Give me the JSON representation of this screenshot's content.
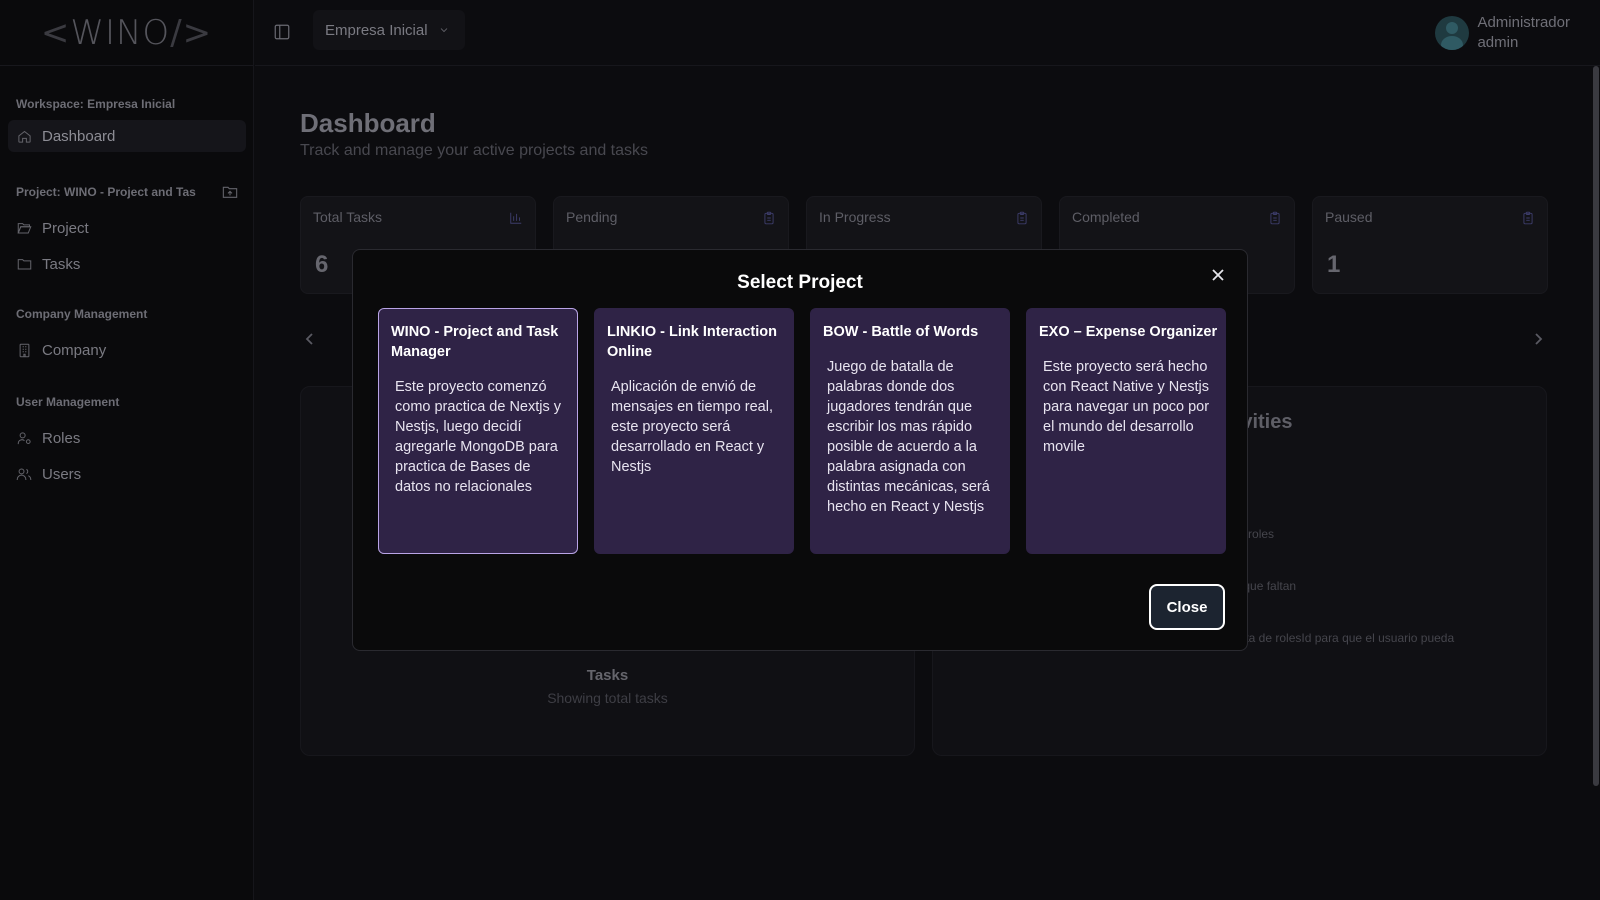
{
  "sidebar": {
    "logo": {
      "left": "<",
      "text": "WINO",
      "right": "/>"
    },
    "workspace_heading": "Workspace: Empresa Inicial",
    "dashboard_label": "Dashboard",
    "project_heading": "Project: WINO - Project and Tas",
    "project_items": [
      {
        "label": "Project",
        "icon": "folder-open-icon"
      },
      {
        "label": "Tasks",
        "icon": "folder-icon"
      }
    ],
    "company_heading": "Company Management",
    "company_items": [
      {
        "label": "Company",
        "icon": "building-icon"
      }
    ],
    "user_heading": "User Management",
    "user_items": [
      {
        "label": "Roles",
        "icon": "user-cog-icon"
      },
      {
        "label": "Users",
        "icon": "users-icon"
      }
    ]
  },
  "header": {
    "company_select": "Empresa Inicial",
    "user": {
      "name": "Administrador",
      "role": "admin"
    }
  },
  "main": {
    "title": "Dashboard",
    "subtitle": "Track and manage your active projects and tasks",
    "stats": [
      {
        "label": "Total Tasks",
        "value": "6",
        "icon": "bar-chart-icon"
      },
      {
        "label": "Pending",
        "value": "",
        "icon": "clipboard-icon"
      },
      {
        "label": "In Progress",
        "value": "",
        "icon": "clipboard-icon"
      },
      {
        "label": "Completed",
        "value": "",
        "icon": "clipboard-icon"
      },
      {
        "label": "Paused",
        "value": "1",
        "icon": "clipboard-icon"
      }
    ],
    "tasks_panel": {
      "caption": "Tasks",
      "sub": "Showing total tasks"
    },
    "activities_panel": {
      "title_visible": "ctivities",
      "items": [
        "ta de roles",
        "oles que faltan",
        "la vista de rolesId para que el usuario pueda"
      ]
    }
  },
  "modal": {
    "title": "Select Project",
    "close_label": "Close",
    "projects": [
      {
        "name": "WINO - Project and Task Manager",
        "description": "Este proyecto comenzó como practica de Nextjs y Nestjs, luego decidí agregarle MongoDB para practica de Bases de datos no relacionales",
        "selected": true
      },
      {
        "name": "LINKIO - Link Interaction Online",
        "description": "Aplicación de envió de mensajes en tiempo real, este proyecto será desarrollado en React y Nestjs",
        "selected": false
      },
      {
        "name": "BOW - Battle of Words",
        "description": "Juego de batalla de palabras donde dos jugadores tendrán que escribir los mas rápido posible de acuerdo a la palabra asignada con distintas mecánicas, será hecho en React y Nestjs",
        "selected": false
      },
      {
        "name": "EXO – Expense Organizer",
        "description": "Este proyecto será hecho con React Native y Nestjs para navegar un poco por el mundo del desarrollo movile",
        "selected": false
      }
    ]
  },
  "colors": {
    "card_bg": "#2f2346",
    "selected_border": "#b9a4e6",
    "close_button_bg": "#1c2430"
  }
}
